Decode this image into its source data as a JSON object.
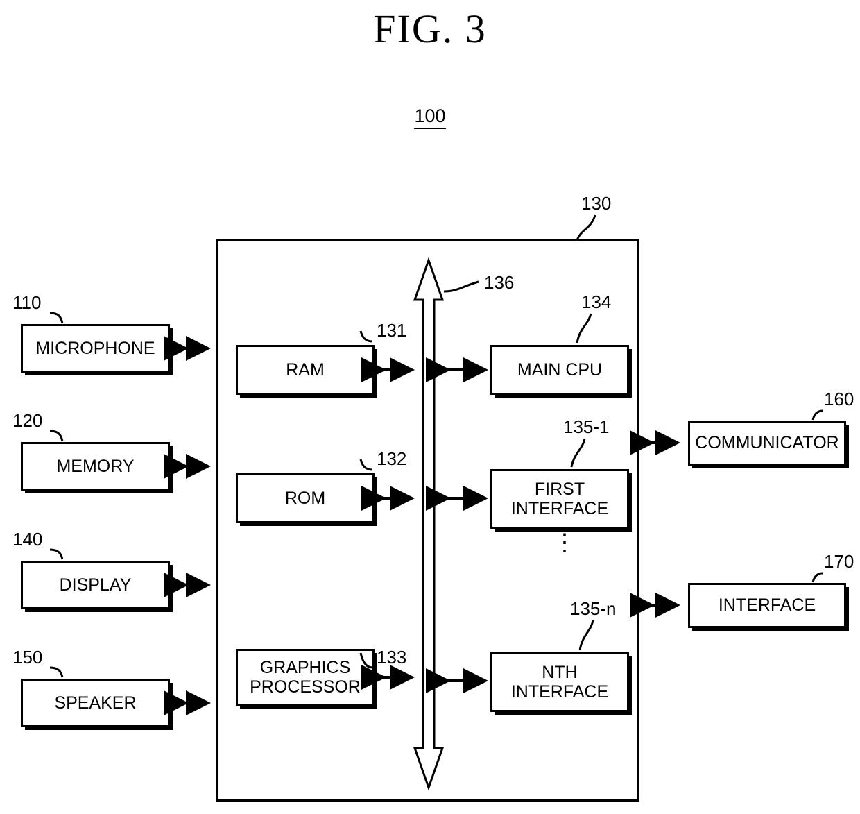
{
  "figure": {
    "title": "FIG. 3",
    "system_ref": "100"
  },
  "external_blocks": [
    {
      "label": "MICROPHONE",
      "ref": "110"
    },
    {
      "label": "MEMORY",
      "ref": "120"
    },
    {
      "label": "DISPLAY",
      "ref": "140"
    },
    {
      "label": "SPEAKER",
      "ref": "150"
    }
  ],
  "right_blocks": [
    {
      "label": "COMMUNICATOR",
      "ref": "160"
    },
    {
      "label": "INTERFACE",
      "ref": "170"
    }
  ],
  "processor": {
    "ref": "130",
    "bus_ref": "136",
    "left_blocks": [
      {
        "label": "RAM",
        "ref": "131"
      },
      {
        "label": "ROM",
        "ref": "132"
      },
      {
        "label": "GRAPHICS PROCESSOR",
        "label_line1": "GRAPHICS",
        "label_line2": "PROCESSOR",
        "ref": "133"
      }
    ],
    "right_blocks": [
      {
        "label": "MAIN CPU",
        "ref": "134"
      },
      {
        "label": "FIRST INTERFACE",
        "label_line1": "FIRST",
        "label_line2": "INTERFACE",
        "ref": "135-1"
      },
      {
        "label": "NTH INTERFACE",
        "label_line1": "NTH",
        "label_line2": "INTERFACE",
        "ref": "135-n"
      }
    ],
    "vertical_ellipsis": "⋮"
  }
}
